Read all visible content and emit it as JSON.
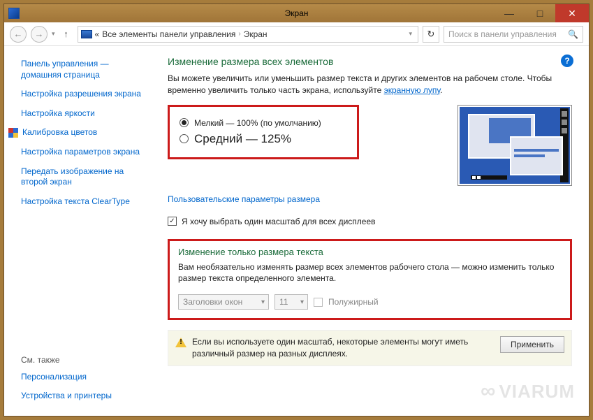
{
  "window": {
    "title": "Экран"
  },
  "title_controls": {
    "minimize": "—",
    "maximize": "□",
    "close": "✕"
  },
  "nav": {
    "back": "←",
    "forward": "→",
    "up": "↑",
    "dropdown": "▾",
    "crumb_prefix": "«",
    "crumb_all": "Все элементы панели управления",
    "crumb_current": "Экран",
    "refresh": "↻"
  },
  "search": {
    "placeholder": "Поиск в панели управления",
    "icon": "🔍"
  },
  "sidebar": {
    "items": [
      "Панель управления — домашняя страница",
      "Настройка разрешения экрана",
      "Настройка яркости",
      "Калибровка цветов",
      "Настройка параметров экрана",
      "Передать изображение на второй экран",
      "Настройка текста ClearType"
    ],
    "also_heading": "См. также",
    "also": [
      "Персонализация",
      "Устройства и принтеры"
    ]
  },
  "help": "?",
  "main": {
    "heading": "Изменение размера всех элементов",
    "intro_1": "Вы можете увеличить или уменьшить размер текста и других элементов на рабочем столе. Чтобы временно увеличить только часть экрана, используйте ",
    "intro_link": "экранную лупу",
    "intro_2": ".",
    "radios": {
      "small": "Мелкий — 100% (по умолчанию)",
      "medium": "Средний — 125%"
    },
    "custom_link": "Пользовательские параметры размера",
    "single_scale_cb": "Я хочу выбрать один масштаб для всех дисплеев"
  },
  "text_section": {
    "heading": "Изменение только размера текста",
    "desc": "Вам необязательно изменять размер всех элементов рабочего стола — можно изменить только размер текста определенного элемента.",
    "dropdown_element": "Заголовки окон",
    "dropdown_size": "11",
    "bold_label": "Полужирный"
  },
  "footer": {
    "warning": "Если вы используете один масштаб, некоторые элементы могут иметь различный размер на разных дисплеях.",
    "apply": "Применить"
  },
  "watermark": "VIARUM"
}
